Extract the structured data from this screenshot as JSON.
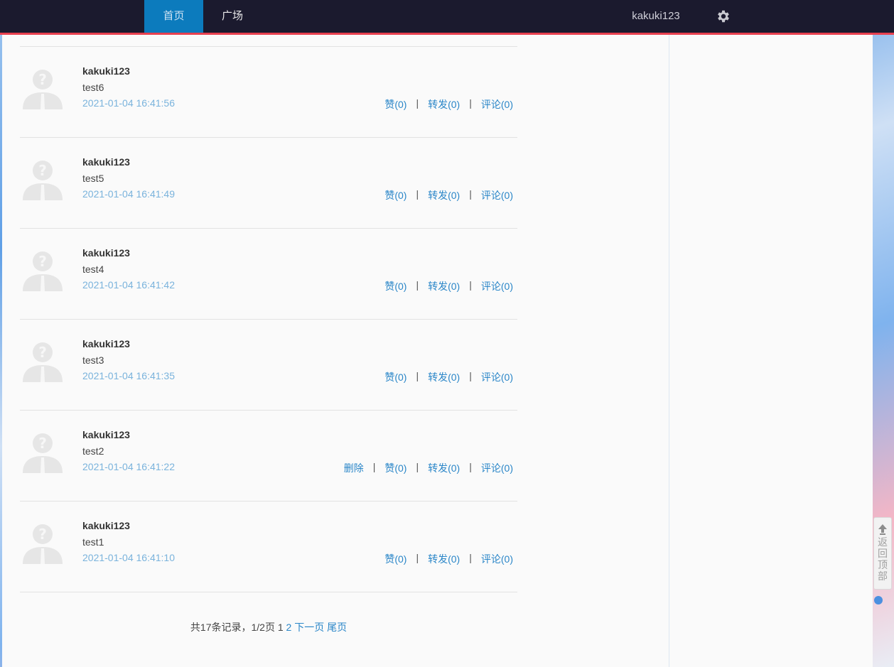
{
  "nav": {
    "tabs": [
      {
        "label": "首页",
        "active": true
      },
      {
        "label": "广场",
        "active": false
      }
    ],
    "username": "kakuki123",
    "settings_icon": "gear-icon"
  },
  "feed": {
    "posts": [
      {
        "user": "kakuki123",
        "text": "test6",
        "time": "2021-01-04 16:41:56",
        "like": "赞(0)",
        "repost": "转发(0)",
        "comment": "评论(0)"
      },
      {
        "user": "kakuki123",
        "text": "test5",
        "time": "2021-01-04 16:41:49",
        "like": "赞(0)",
        "repost": "转发(0)",
        "comment": "评论(0)"
      },
      {
        "user": "kakuki123",
        "text": "test4",
        "time": "2021-01-04 16:41:42",
        "like": "赞(0)",
        "repost": "转发(0)",
        "comment": "评论(0)"
      },
      {
        "user": "kakuki123",
        "text": "test3",
        "time": "2021-01-04 16:41:35",
        "like": "赞(0)",
        "repost": "转发(0)",
        "comment": "评论(0)"
      },
      {
        "user": "kakuki123",
        "text": "test2",
        "time": "2021-01-04 16:41:22",
        "delete": "删除",
        "like": "赞(0)",
        "repost": "转发(0)",
        "comment": "评论(0)"
      },
      {
        "user": "kakuki123",
        "text": "test1",
        "time": "2021-01-04 16:41:10",
        "like": "赞(0)",
        "repost": "转发(0)",
        "comment": "评论(0)"
      }
    ],
    "separator": "|"
  },
  "pagination": {
    "summary": "共17条记录，1/2页 1",
    "page2": "2",
    "next": "下一页",
    "last": "尾页"
  },
  "back_to_top": {
    "label": "返回顶部",
    "chars": [
      "返",
      "回",
      "顶",
      "部"
    ]
  }
}
